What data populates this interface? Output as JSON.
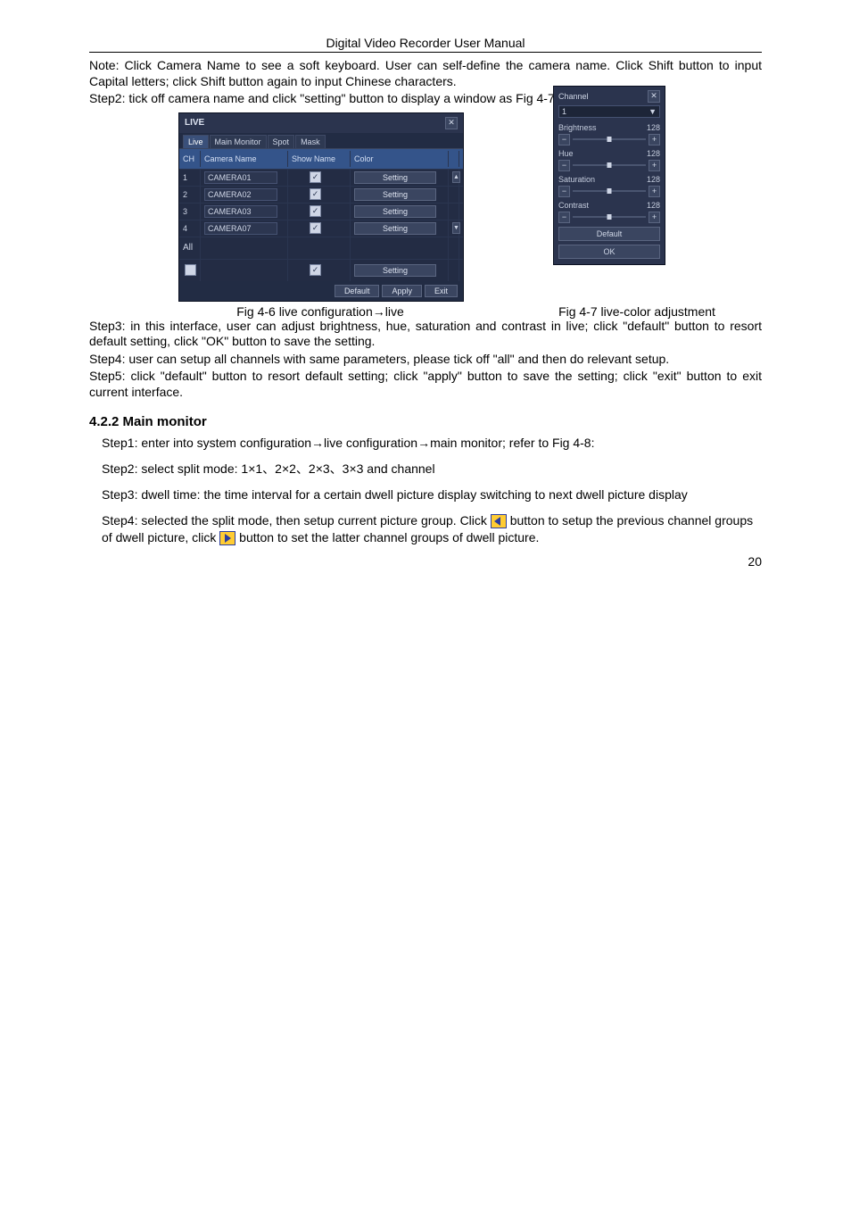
{
  "header": {
    "title": "Digital Video Recorder User Manual"
  },
  "intro": {
    "note": "Note: Click Camera Name to see a soft keyboard. User can self-define the camera name. Click Shift button to input Capital letters; click Shift button again to input Chinese characters.",
    "step2": "Step2: tick off camera name and click \"setting\" button to display a window as Fig 4-7:"
  },
  "fig46": {
    "title": "LIVE",
    "tabs": [
      "Live",
      "Main Monitor",
      "Spot",
      "Mask"
    ],
    "columns": {
      "ch": "CH",
      "camera_name": "Camera Name",
      "show_name": "Show Name",
      "color": "Color"
    },
    "rows": [
      {
        "ch": "1",
        "name": "CAMERA01",
        "show": true,
        "btn": "Setting"
      },
      {
        "ch": "2",
        "name": "CAMERA02",
        "show": true,
        "btn": "Setting"
      },
      {
        "ch": "3",
        "name": "CAMERA03",
        "show": true,
        "btn": "Setting"
      },
      {
        "ch": "4",
        "name": "CAMERA07",
        "show": true,
        "btn": "Setting"
      }
    ],
    "all_label": "All",
    "all_show": true,
    "all_btn": "Setting",
    "footer": {
      "default": "Default",
      "apply": "Apply",
      "exit": "Exit"
    },
    "caption": "Fig 4-6 live configuration→live"
  },
  "fig47": {
    "channel_label": "Channel",
    "channel_value": "1",
    "sliders": [
      {
        "name": "Brightness",
        "value": "128"
      },
      {
        "name": "Hue",
        "value": "128"
      },
      {
        "name": "Saturation",
        "value": "128"
      },
      {
        "name": "Contrast",
        "value": "128"
      }
    ],
    "default_btn": "Default",
    "ok_btn": "OK",
    "caption": "Fig 4-7 live-color adjustment"
  },
  "post": {
    "step3": "Step3: in this interface, user can adjust brightness, hue, saturation and contrast in live; click \"default\" button to resort default setting, click \"OK\" button to save the setting.",
    "step4": "Step4: user can setup all channels with same parameters, please tick off \"all\" and then do relevant setup.",
    "step5": "Step5: click \"default\" button to resort default setting; click \"apply\" button to save the setting; click \"exit\" button to exit current interface."
  },
  "section": {
    "heading": "4.2.2  Main monitor",
    "s1": "Step1: enter into system configuration→live configuration→main monitor; refer to Fig 4-8:",
    "s2": "Step2: select split mode: 1×1、2×2、2×3、3×3 and channel",
    "s3": "Step3: dwell time: the time interval for a certain dwell picture display switching to next dwell picture display",
    "s4a": "Step4: selected the split mode, then setup current picture group. Click ",
    "s4b": "button to setup the previous channel groups of dwell picture, click ",
    "s4c": " button to set the latter channel groups of dwell picture."
  },
  "page_number": "20"
}
